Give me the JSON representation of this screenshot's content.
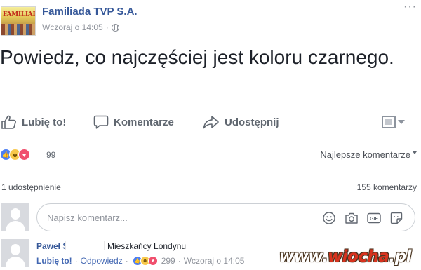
{
  "post": {
    "page_name": "Familiada TVP S.A.",
    "page_logo_text": "FAMILIADA",
    "timestamp": "Wczoraj o 14:05",
    "separator": "·",
    "text": "Powiedz, co najczęściej jest koloru czarnego.",
    "more_label": "···"
  },
  "actions": {
    "like_label": "Lubię to!",
    "comment_label": "Komentarze",
    "share_label": "Udostępnij"
  },
  "reactions": {
    "types": [
      "like",
      "haha",
      "love"
    ],
    "count": "99",
    "sort_label": "Najlepsze komentarze"
  },
  "stats": {
    "shares": "1 udostępnienie",
    "comments": "155 komentarzy"
  },
  "composer": {
    "placeholder": "Napisz komentarz...",
    "tools": [
      "emoji-icon",
      "camera-icon",
      "gif-icon",
      "sticker-icon"
    ],
    "gif_label": "GIF"
  },
  "comment": {
    "author": "Paweł S",
    "text": "Mieszkańcy Londynu",
    "like_label": "Lubię to!",
    "reply_label": "Odpowiedz",
    "reaction_count": "299",
    "timestamp": "Wczoraj o 14:05",
    "separator": "·"
  },
  "watermark": {
    "prefix": "www.",
    "brand": "wiocha",
    "suffix": ".pl"
  },
  "colors": {
    "link": "#365899",
    "like": "#4c7ef3",
    "haha": "#f7c84b",
    "love": "#f0506e",
    "muted": "#90949c"
  }
}
